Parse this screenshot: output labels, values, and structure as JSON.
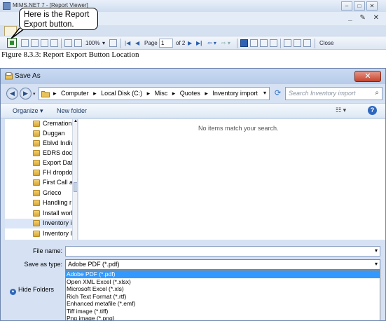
{
  "viewer": {
    "title": "MIMS.NET 7 - [Report Viewer]",
    "callout_line1": "Here is the Report",
    "callout_line2": "Export button.",
    "toolbar": {
      "zoom": "100%",
      "page_label": "Page",
      "page_value": "1",
      "page_of": "of 2",
      "close_label": "Close"
    }
  },
  "caption": "Figure 8.3.3: Report Export Button Location",
  "dialog": {
    "title": "Save As",
    "address": [
      "Computer",
      "Local Disk (C:)",
      "Misc",
      "Quotes",
      "Inventory import"
    ],
    "search_placeholder": "Search Inventory import",
    "organize_label": "Organize ▾",
    "new_folder_label": "New folder",
    "empty_message": "No items match your search.",
    "nav_items": [
      "Cremation",
      "Duggan",
      "Eblvd Indiv",
      "EDRS docu",
      "Export Data",
      "FH dropdo",
      "First Call a",
      "Grieco",
      "Handling r",
      "Install worl",
      "Inventory i",
      "Inventory I"
    ],
    "file_name_label": "File name:",
    "file_name_value": "",
    "save_type_label": "Save as type:",
    "save_type_value": "Adobe PDF (*.pdf)",
    "type_options": [
      "Adobe PDF (*.pdf)",
      "Open XML Excel (*.xlsx)",
      "Microsoft Excel (*.xls)",
      "Rich Text Format (*.rtf)",
      "Enhanced metafile (*.emf)",
      "Tiff image (*.tiff)",
      "Png image (*.png)"
    ],
    "hide_folders_label": "Hide Folders"
  },
  "colors": {
    "selection": "#3399ff",
    "dialog_chrome": "#d6e2f3",
    "close_button": "#c7442c"
  }
}
